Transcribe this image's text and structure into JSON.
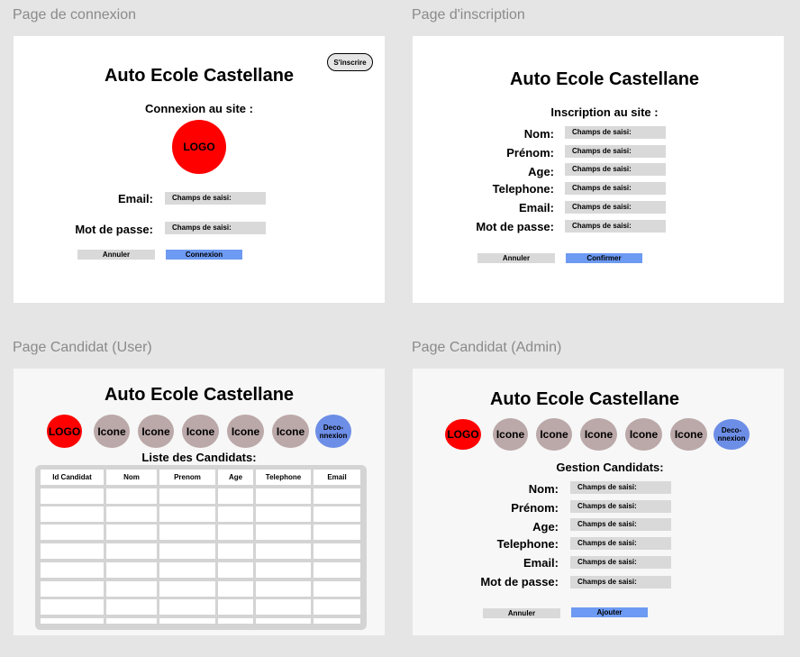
{
  "frames": {
    "connexion": {
      "label": "Page de connexion",
      "title": "Auto Ecole Castellane",
      "signup_button": "S'inscrire",
      "subtitle": "Connexion au site :",
      "logo": "LOGO",
      "fields": [
        {
          "label": "Email:",
          "placeholder": "Champs de saisi:"
        },
        {
          "label": "Mot de passe:",
          "placeholder": "Champs de saisi:"
        }
      ],
      "cancel": "Annuler",
      "submit": "Connexion"
    },
    "inscription": {
      "label": "Page d'inscription",
      "title": "Auto Ecole Castellane",
      "subtitle": "Inscription au site :",
      "fields": [
        {
          "label": "Nom:",
          "placeholder": "Champs de saisi:"
        },
        {
          "label": "Prénom:",
          "placeholder": "Champs de saisi:"
        },
        {
          "label": "Age:",
          "placeholder": "Champs de saisi:"
        },
        {
          "label": "Telephone:",
          "placeholder": "Champs de saisi:"
        },
        {
          "label": "Email:",
          "placeholder": "Champs de saisi:"
        },
        {
          "label": "Mot de passe:",
          "placeholder": "Champs de saisi:"
        }
      ],
      "cancel": "Annuler",
      "submit": "Confirmer"
    },
    "candidat_user": {
      "label": "Page Candidat (User)",
      "title": "Auto Ecole Castellane",
      "nav": {
        "logo": "LOGO",
        "icons": [
          "Icone",
          "Icone",
          "Icone",
          "Icone",
          "Icone"
        ],
        "logout": "Deco-nnexion"
      },
      "subtitle": "Liste des Candidats:",
      "table_headers": [
        "Id Candidat",
        "Nom",
        "Prenom",
        "Age",
        "Telephone",
        "Email"
      ]
    },
    "candidat_admin": {
      "label": "Page Candidat (Admin)",
      "title": "Auto Ecole Castellane",
      "nav": {
        "logo": "LOGO",
        "icons": [
          "Icone",
          "Icone",
          "Icone",
          "Icone",
          "Icone"
        ],
        "logout": "Deco-nnexion"
      },
      "subtitle": "Gestion Candidats:",
      "fields": [
        {
          "label": "Nom:",
          "placeholder": "Champs de saisi:"
        },
        {
          "label": "Prénom:",
          "placeholder": "Champs de saisi:"
        },
        {
          "label": "Age:",
          "placeholder": "Champs de saisi:"
        },
        {
          "label": "Telephone:",
          "placeholder": "Champs de saisi:"
        },
        {
          "label": "Email:",
          "placeholder": "Champs de saisi:"
        },
        {
          "label": "Mot de passe:",
          "placeholder": "Champs de saisi:"
        }
      ],
      "cancel": "Annuler",
      "submit": "Ajouter"
    }
  },
  "colors": {
    "canvas": "#e5e5e5",
    "logo_red": "#ff0000",
    "icon_gray": "#bba8a8",
    "logout_blue": "#6d8ee6",
    "primary_button": "#6d9af2",
    "field_gray": "#d9d9d9"
  }
}
